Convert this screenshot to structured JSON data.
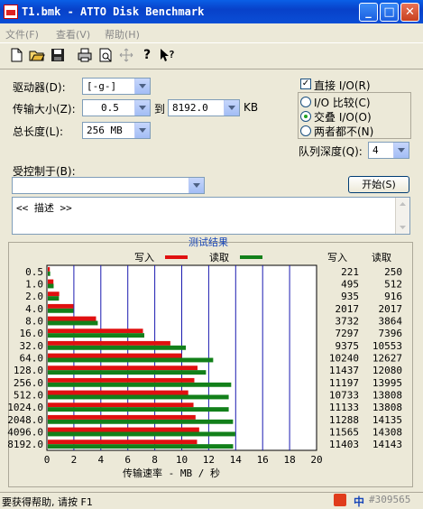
{
  "window": {
    "title": "T1.bmk - ATTO Disk Benchmark",
    "minimize": "_",
    "maximize": "□",
    "close": "✕"
  },
  "menu": [
    {
      "label": "文件(F)"
    },
    {
      "label": "查看(V)"
    },
    {
      "label": "帮助(H)"
    }
  ],
  "toolbar": {
    "icons": [
      "new-file-icon",
      "open-folder-icon",
      "save-icon",
      "print-icon",
      "print-preview-icon",
      "move-icon",
      "help-icon",
      "context-help-icon"
    ]
  },
  "settings": {
    "drive_label": "驱动器(D):",
    "drive_value": "[-g-]",
    "transfer_label": "传输大小(Z):",
    "transfer_from": "0.5",
    "transfer_to_label": "到",
    "transfer_to": "8192.0",
    "transfer_unit": "KB",
    "length_label": "总长度(L):",
    "length_value": "256 MB",
    "controlled_label": "受控制于(B):",
    "controlled_value": "",
    "direct_io_label": "直接 I/O(R)",
    "direct_io_checked": true,
    "radio_compare": "I/O 比较(C)",
    "radio_overlap": "交叠 I/O(O)",
    "radio_neither": "两者都不(N)",
    "radio_selected": "overlap",
    "queue_label": "队列深度(Q):",
    "queue_value": "4",
    "start_button": "开始(S)"
  },
  "description": "<< 描述 >>",
  "chart_data": {
    "type": "bar",
    "title": "测试结果",
    "legend_write": "写入",
    "legend_read": "读取",
    "xlabel": "传输速率 - MB / 秒",
    "xlim": [
      0,
      20
    ],
    "xticks": [
      "0",
      "2",
      "4",
      "6",
      "8",
      "10",
      "12",
      "14",
      "16",
      "18",
      "20"
    ],
    "categories": [
      "0.5",
      "1.0",
      "2.0",
      "4.0",
      "8.0",
      "16.0",
      "32.0",
      "64.0",
      "128.0",
      "256.0",
      "512.0",
      "1024.0",
      "2048.0",
      "4096.0",
      "8192.0"
    ],
    "series": [
      {
        "name": "写入",
        "color": "#e01010",
        "values": [
          221,
          495,
          935,
          2017,
          3732,
          7297,
          9375,
          10240,
          11437,
          11197,
          10733,
          11133,
          11288,
          11565,
          11403
        ]
      },
      {
        "name": "读取",
        "color": "#12801a",
        "values": [
          250,
          512,
          916,
          2017,
          3864,
          7396,
          10553,
          12627,
          12080,
          13995,
          13808,
          13808,
          14135,
          14308,
          14143
        ]
      }
    ],
    "col_write_header": "写入",
    "col_read_header": "读取"
  },
  "status": {
    "text": "要获得帮助, 请按 F1",
    "tray_text": "中",
    "watermark": "#309565"
  }
}
